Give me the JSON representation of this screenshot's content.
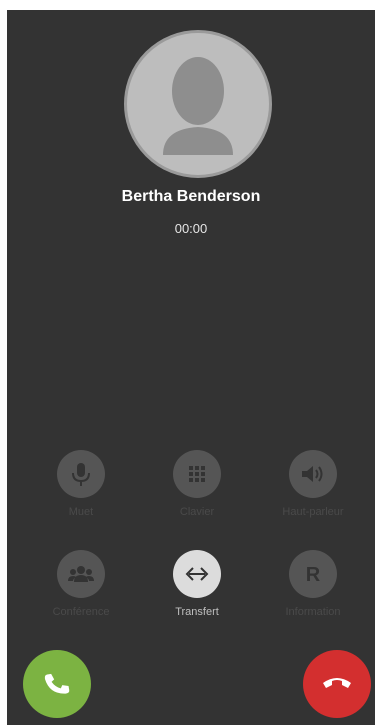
{
  "caller": {
    "name": "Bertha Benderson",
    "duration": "00:00"
  },
  "actions": [
    {
      "label": "Muet",
      "icon": "microphone-icon",
      "active": false
    },
    {
      "label": "Clavier",
      "icon": "dialpad-icon",
      "active": false
    },
    {
      "label": "Haut-parleur",
      "icon": "speaker-icon",
      "active": false
    },
    {
      "label": "Conférence",
      "icon": "group-icon",
      "active": false
    },
    {
      "label": "Transfert",
      "icon": "transfer-icon",
      "active": true
    },
    {
      "label": "Information",
      "icon": "r-icon",
      "active": false
    }
  ],
  "buttons": {
    "answer_icon": "phone-answer-icon",
    "hangup_icon": "phone-hangup-icon",
    "answer_color": "#7cb342",
    "hangup_color": "#d32f2f"
  },
  "colors": {
    "background": "#333333"
  }
}
